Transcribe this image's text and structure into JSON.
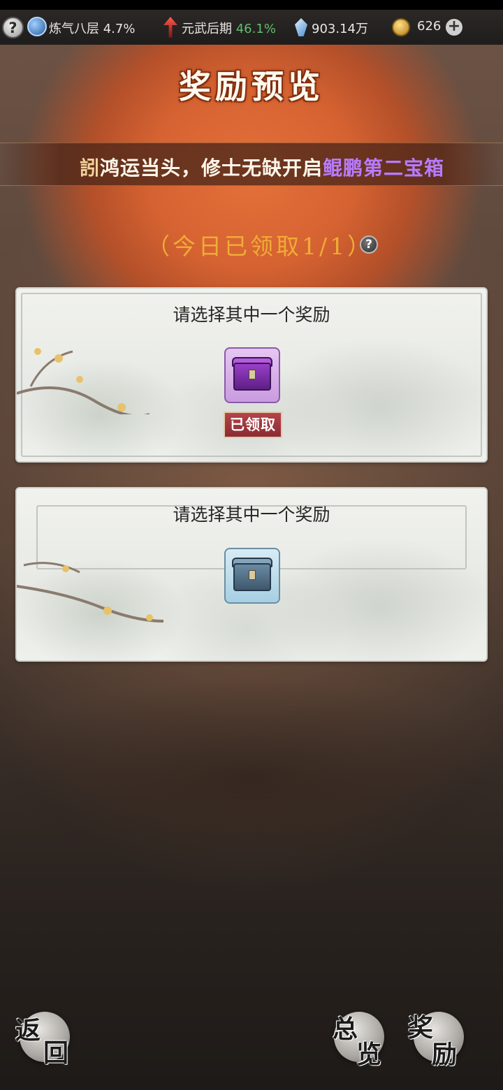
{
  "topbar": {
    "help": "?",
    "cultivation": "炼气八层 4.7%",
    "martial_label": "元武后期",
    "martial_pct": "46.1%",
    "spirit_stones": "903.14万",
    "coins": "626",
    "add": "+"
  },
  "page": {
    "title": "奖励预览"
  },
  "banner": {
    "lead": "訠",
    "text": "鸿运当头，修士无缺开启",
    "highlight": "鲲鹏第二宝箱"
  },
  "claim_status": "（今日已领取1/1）",
  "help_small": "?",
  "cards": [
    {
      "title": "请选择其中一个奖励",
      "chest": "purple-chest-icon",
      "badge": "已领取"
    },
    {
      "title": "请选择其中一个奖励",
      "chest": "blue-chest-icon"
    }
  ],
  "buttons": {
    "back_top": "返",
    "back_bottom": "回",
    "overview_top": "总",
    "overview_bottom": "览",
    "reward_top": "奖",
    "reward_bottom": "励"
  },
  "colors": {
    "accent_purple": "#b77bff",
    "claim_gold": "#f2b437",
    "badge_red": "#9b3339",
    "progress_green": "#5fbf6a"
  }
}
